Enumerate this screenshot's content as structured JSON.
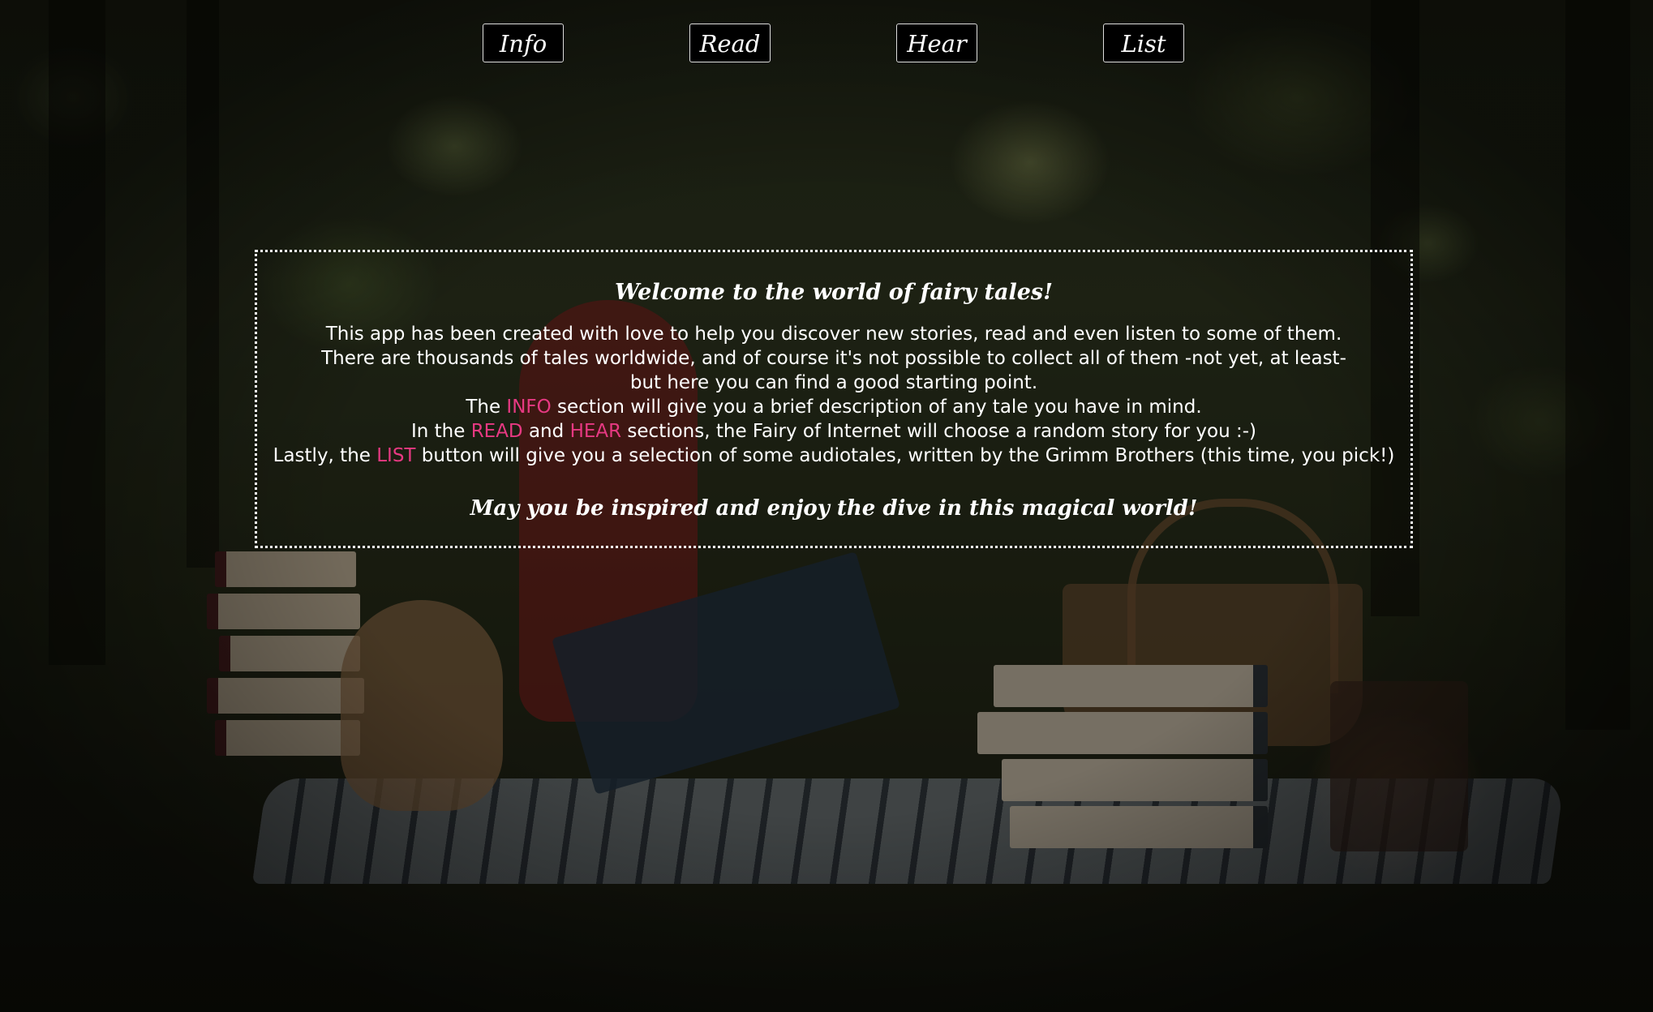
{
  "nav": {
    "info_label": "Info",
    "read_label": "Read",
    "hear_label": "Hear",
    "list_label": "List"
  },
  "welcome": {
    "title": "Welcome to the world of fairy tales!",
    "line1": "This app has been created with love to help you discover new stories, read and even listen to some of them.",
    "line2": "There are thousands of tales worldwide, and of course it's not possible to collect all of them -not yet, at least-",
    "line3": "but here you can find a good starting point.",
    "line4": {
      "prefix": "The ",
      "highlight": "INFO",
      "suffix": " section will give you a brief description of any tale you have in mind."
    },
    "line5": {
      "prefix": "In the ",
      "highlight1": "READ",
      "middle": " and ",
      "highlight2": "HEAR",
      "suffix": " sections, the Fairy of Internet will choose a random story for you :-)"
    },
    "line6": {
      "prefix": "Lastly, the ",
      "highlight": "LIST",
      "suffix": " button will give you a selection of some audiotales, written by the Grimm Brothers (this time, you pick!)"
    },
    "closing": "May you be inspired and enjoy the dive in this magical world!"
  },
  "colors": {
    "highlight": "#e63982",
    "button_bg": "#000000",
    "text": "#ffffff"
  }
}
